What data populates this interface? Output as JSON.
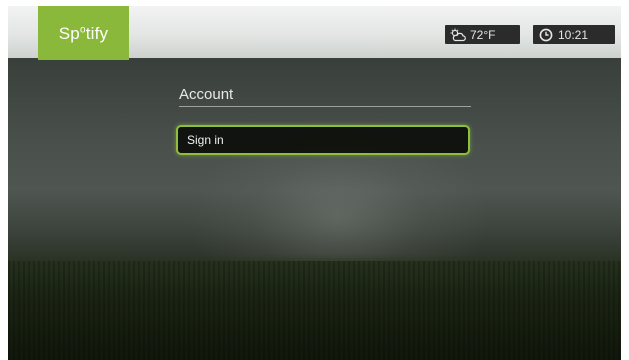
{
  "app": {
    "logo_text": "Sp",
    "logo_text_sup": "o",
    "logo_text_end": "tify"
  },
  "status_bar": {
    "weather": {
      "icon": "cloud-sun-icon",
      "temperature": "72°F"
    },
    "clock": {
      "icon": "clock-icon",
      "time": "10:21"
    }
  },
  "menu": {
    "title": "Account",
    "items": [
      {
        "label": "Sign in",
        "selected": true
      }
    ]
  },
  "colors": {
    "accent": "#8ab83a",
    "status_bg": "#2a2b2a"
  }
}
